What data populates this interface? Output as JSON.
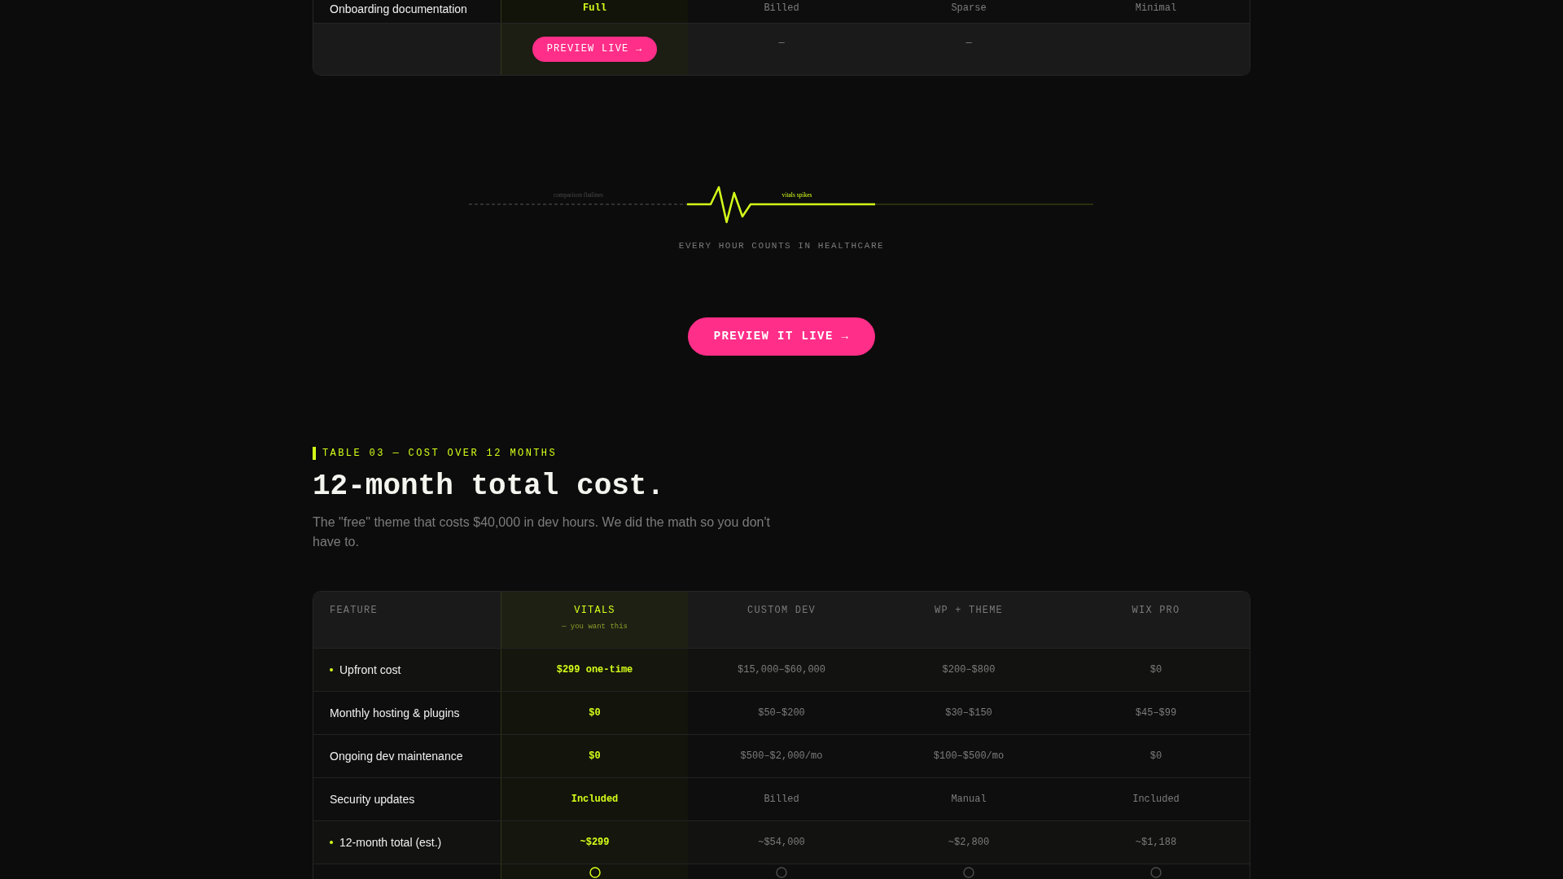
{
  "top_table": {
    "columns": [
      {
        "highlighted": false
      },
      {
        "highlighted": true
      },
      {
        "highlighted": false
      },
      {
        "highlighted": false
      },
      {
        "highlighted": false
      }
    ],
    "rows": [
      {
        "kind": "values",
        "cells": [
          {
            "kind": "text",
            "text": "Onboarding documentation"
          },
          {
            "kind": "text",
            "text": "Full"
          },
          {
            "kind": "text",
            "text": "Billed"
          },
          {
            "kind": "text",
            "text": "Sparse"
          },
          {
            "kind": "text",
            "text": "Minimal"
          }
        ]
      },
      {
        "kind": "actions",
        "cells": [
          {
            "kind": "empty"
          },
          {
            "kind": "button",
            "text": "PREVIEW LIVE →"
          },
          {
            "kind": "text",
            "text": "—"
          },
          {
            "kind": "text",
            "text": "—"
          },
          {
            "kind": "empty"
          }
        ]
      }
    ]
  },
  "heartbeat": {
    "flat_label": "comparison flatlines",
    "spike_label": "vitals spikes",
    "caption": "EVERY HOUR COUNTS IN HEALTHCARE"
  },
  "cta_button": {
    "label": "PREVIEW IT LIVE →"
  },
  "section": {
    "eyebrow": "TABLE 03 — COST OVER 12 MONTHS",
    "title": "12-month total cost.",
    "description": "The \"free\" theme that costs $40,000 in dev hours. We did the math so you don't have to."
  },
  "cost_table": {
    "columns": [
      {
        "label": "FEATURE",
        "highlighted": false
      },
      {
        "label": "VITALS",
        "note": "— you want this",
        "highlighted": true
      },
      {
        "label": "CUSTOM DEV",
        "highlighted": false
      },
      {
        "label": "WP + THEME",
        "highlighted": false
      },
      {
        "label": "WIX PRO",
        "highlighted": false
      }
    ],
    "rows": [
      {
        "kind": "values",
        "highlighted": true,
        "cells": [
          "Upfront cost",
          "$299 one-time",
          "$15,000–$60,000",
          "$200–$800",
          "$0"
        ]
      },
      {
        "kind": "values",
        "highlighted": false,
        "cells": [
          "Monthly hosting & plugins",
          "$0",
          "$50–$200",
          "$30–$150",
          "$45–$99"
        ]
      },
      {
        "kind": "values",
        "highlighted": false,
        "cells": [
          "Ongoing dev maintenance",
          "$0",
          "$500–$2,000/mo",
          "$100–$500/mo",
          "$0"
        ]
      },
      {
        "kind": "values",
        "highlighted": false,
        "cells": [
          "Security updates",
          "Included",
          "Billed",
          "Manual",
          "Included"
        ]
      },
      {
        "kind": "values",
        "highlighted": true,
        "cells": [
          "12-month total (est.)",
          "~$299",
          "~$54,000",
          "~$2,800",
          "~$1,188"
        ]
      },
      {
        "kind": "marks"
      }
    ]
  }
}
